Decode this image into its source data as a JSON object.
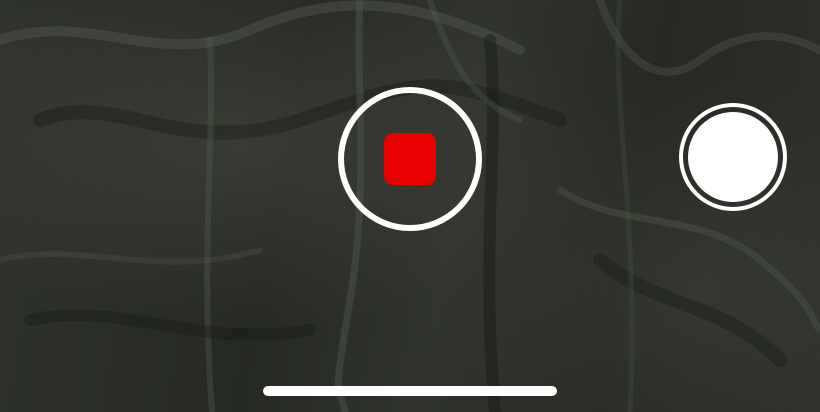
{
  "camera": {
    "mode": "video-recording",
    "controls": {
      "record_button_icon": "stop-icon",
      "shutter_button_icon": "shutter-icon"
    },
    "colors": {
      "stop_accent": "#e80000",
      "control_outline": "#ffffff"
    }
  }
}
